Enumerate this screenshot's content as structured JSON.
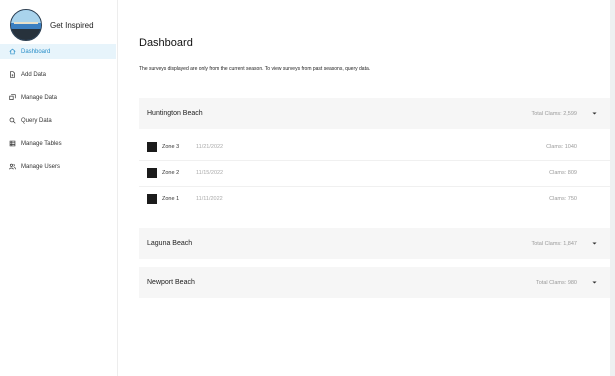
{
  "app": {
    "title": "Get Inspired"
  },
  "sidebar": {
    "items": [
      {
        "label": "Dashboard",
        "icon": "home-icon",
        "active": true
      },
      {
        "label": "Add Data",
        "icon": "document-icon"
      },
      {
        "label": "Manage Data",
        "icon": "stack-icon"
      },
      {
        "label": "Query Data",
        "icon": "search-icon"
      },
      {
        "label": "Manage Tables",
        "icon": "table-icon"
      },
      {
        "label": "Manage Users",
        "icon": "users-icon"
      }
    ]
  },
  "main": {
    "title": "Dashboard",
    "notice": "The surveys displayed are only from the current season. To view surveys from past seasons, query data.",
    "beaches": [
      {
        "name": "Huntington Beach",
        "total": "Total Clams: 2,599",
        "zones": [
          {
            "name": "Zone 3",
            "date": "11/21/2022",
            "clams": "Clams: 1040"
          },
          {
            "name": "Zone 2",
            "date": "11/15/2022",
            "clams": "Clams: 809"
          },
          {
            "name": "Zone 1",
            "date": "11/11/2022",
            "clams": "Clams: 750"
          }
        ]
      },
      {
        "name": "Laguna Beach",
        "total": "Total Clams: 1,847"
      },
      {
        "name": "Newport Beach",
        "total": "Total Clams: 980"
      }
    ]
  },
  "colors": {
    "accent": "#2a8fc9",
    "active_bg": "#e7f4fb"
  }
}
